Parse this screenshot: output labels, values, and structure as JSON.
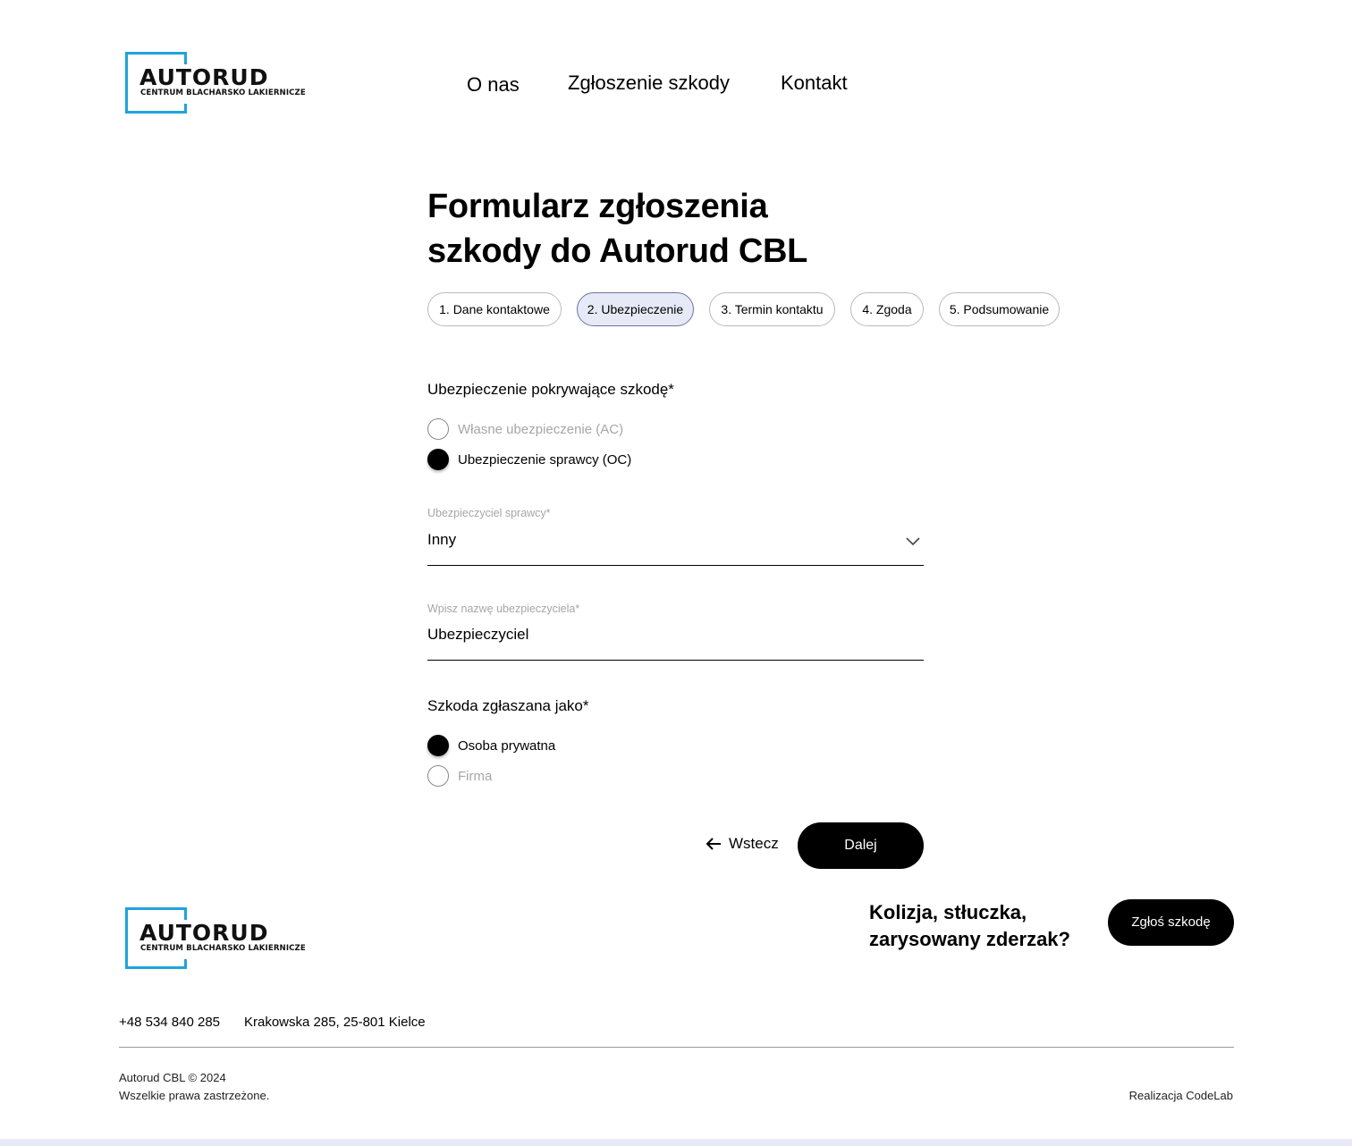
{
  "brand": {
    "name": "AUTORUD",
    "tagline": "CENTRUM BLACHARSKO LAKIERNICZE",
    "accent": "#1fa3dc"
  },
  "nav": {
    "items": [
      {
        "label": "O nas"
      },
      {
        "label": "Zgłoszenie szkody"
      },
      {
        "label": "Kontakt"
      }
    ]
  },
  "form": {
    "title_line1": "Formularz zgłoszenia",
    "title_line2": "szkody do Autorud CBL",
    "steps": [
      {
        "label": "1. Dane kontaktowe",
        "active": false
      },
      {
        "label": "2. Ubezpieczenie",
        "active": true
      },
      {
        "label": "3. Termin kontaktu",
        "active": false
      },
      {
        "label": "4. Zgoda",
        "active": false
      },
      {
        "label": "5. Podsumowanie",
        "active": false
      }
    ],
    "insurance_question": "Ubezpieczenie pokrywające szkodę*",
    "insurance_options": [
      {
        "label": "Własne ubezpieczenie (AC)",
        "checked": false
      },
      {
        "label": "Ubezpieczenie sprawcy (OC)",
        "checked": true
      }
    ],
    "insurer_select": {
      "label": "Ubezpieczyciel sprawcy*",
      "value": "Inny",
      "icon": "chevron-down-icon"
    },
    "insurer_name": {
      "label": "Wpisz nazwę ubezpieczyciela*",
      "value": "Ubezpieczyciel"
    },
    "reported_as_question": "Szkoda zgłaszana jako*",
    "reported_as_options": [
      {
        "label": "Osoba prywatna",
        "checked": true
      },
      {
        "label": "Firma",
        "checked": false
      }
    ],
    "back_label": "Wstecz",
    "next_label": "Dalej"
  },
  "footer": {
    "question_line1": "Kolizja, stłuczka,",
    "question_line2": "zarysowany zderzak?",
    "cta_label": "Zgłoś szkodę",
    "phone": "+48 534 840 285",
    "address": "Krakowska 285, 25-801 Kielce",
    "copyright": "Autorud CBL © 2024",
    "rights": "Wszelkie prawa zastrzeżone.",
    "credits": "Realizacja CodeLab"
  }
}
